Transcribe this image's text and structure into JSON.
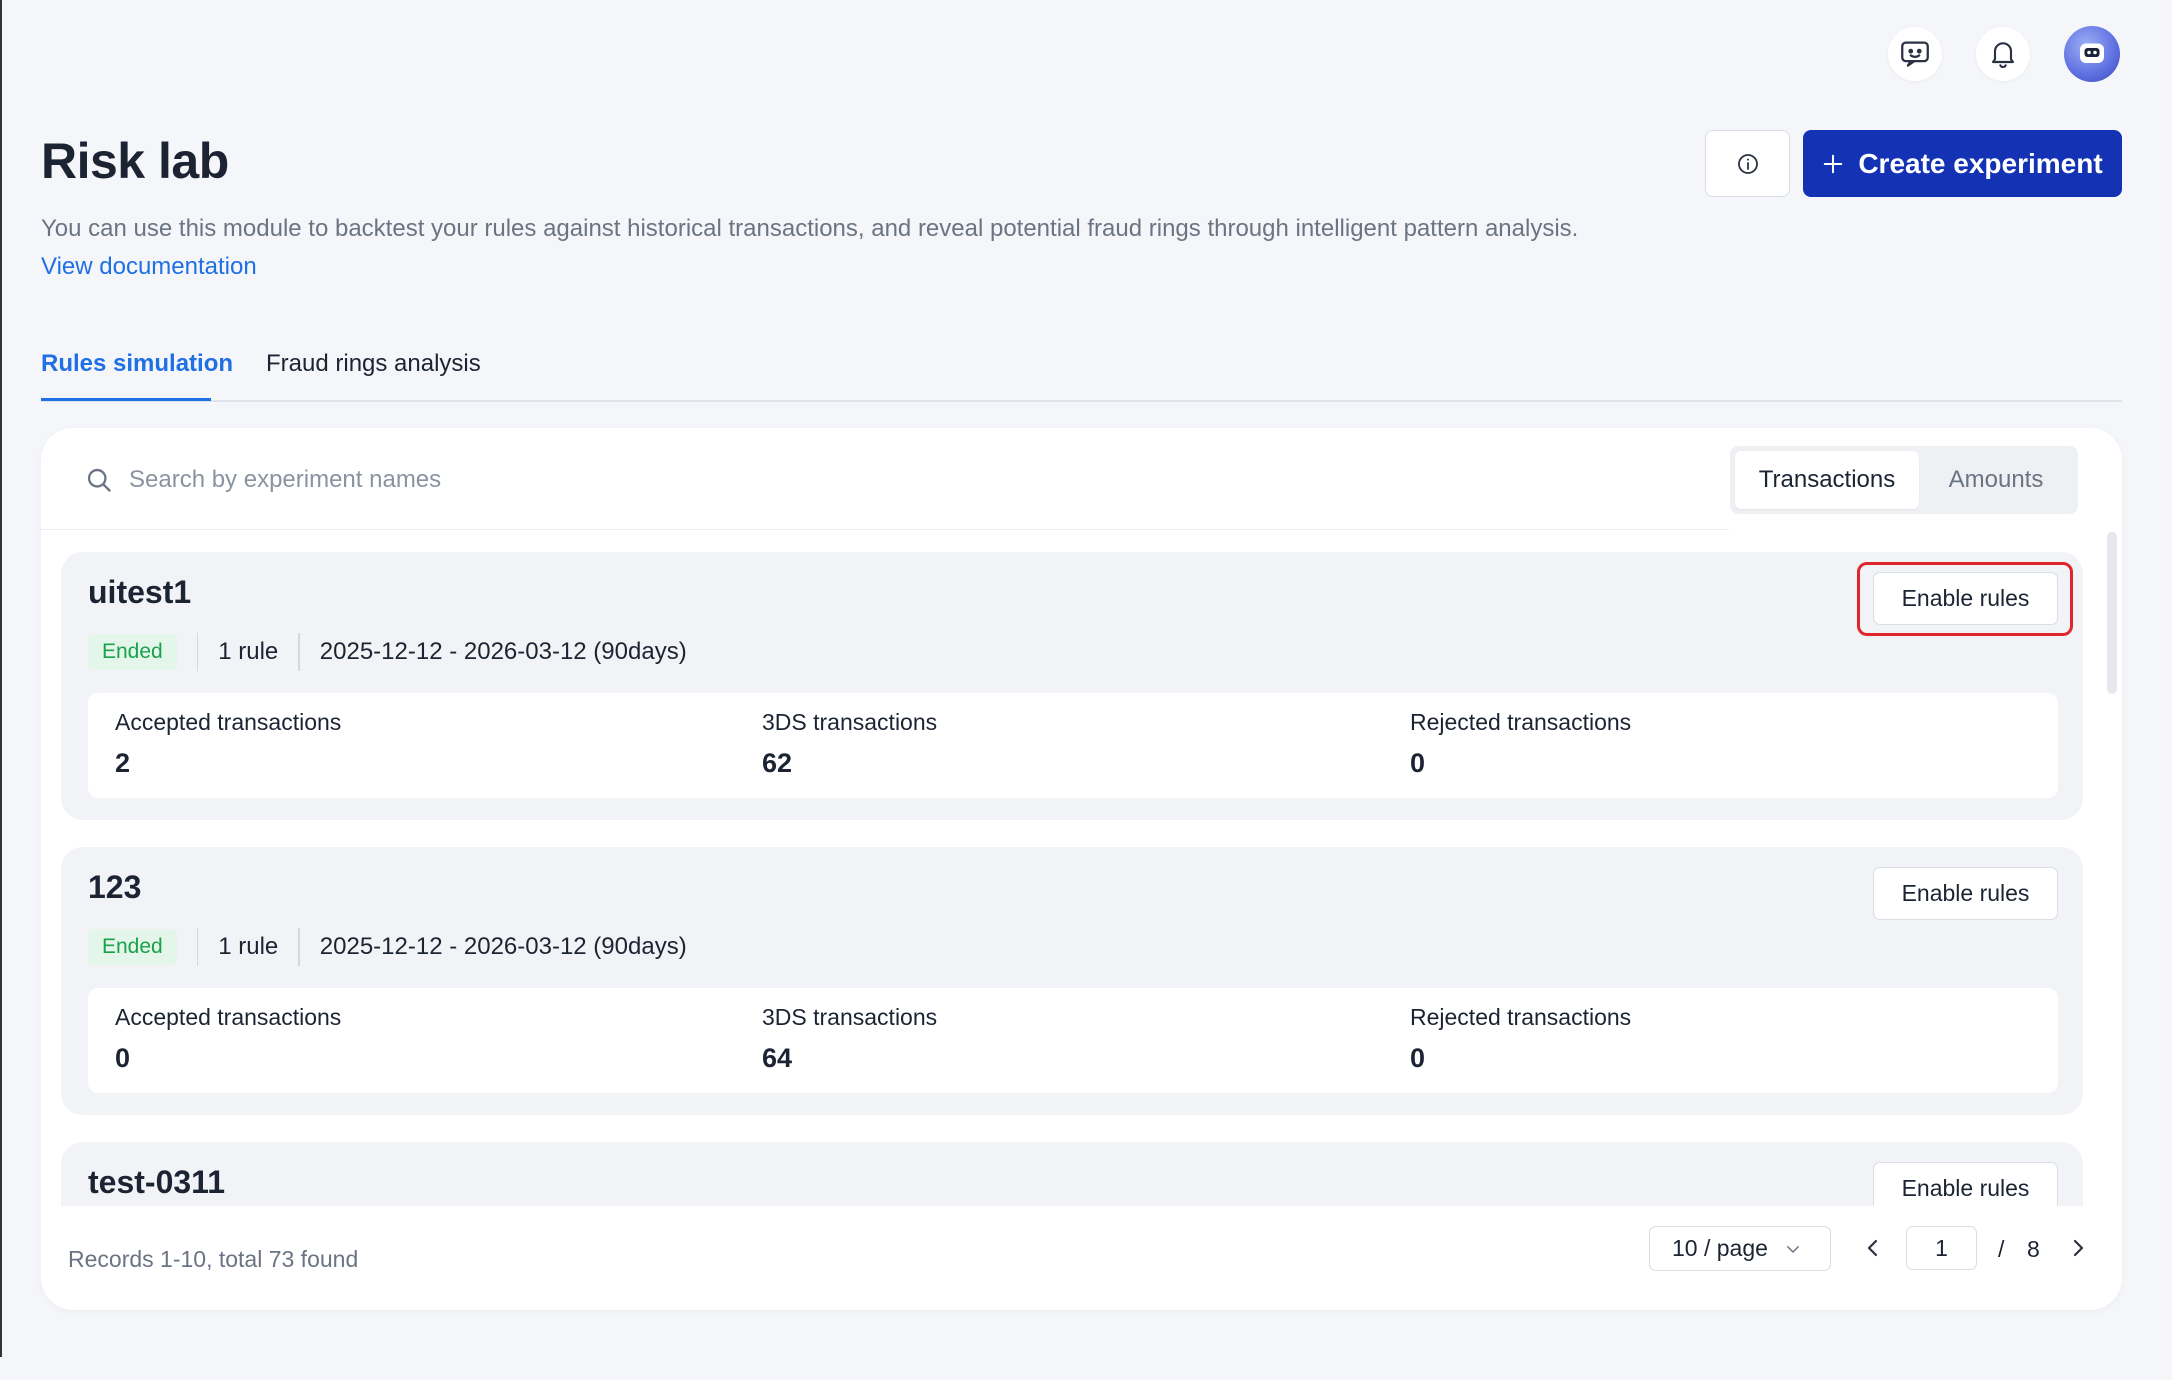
{
  "header": {
    "title": "Risk lab",
    "description": "You can use this module to backtest your rules against historical transactions, and reveal potential fraud rings through intelligent pattern analysis.",
    "doc_link": "View documentation",
    "create_label": "Create experiment"
  },
  "top_icons": [
    "feedback-icon",
    "bell-icon",
    "avatar"
  ],
  "tabs": [
    {
      "label": "Rules simulation",
      "active": true
    },
    {
      "label": "Fraud rings analysis",
      "active": false
    }
  ],
  "search": {
    "placeholder": "Search by experiment names",
    "value": ""
  },
  "toggle": [
    {
      "label": "Transactions",
      "active": true
    },
    {
      "label": "Amounts",
      "active": false
    }
  ],
  "experiments": [
    {
      "name": "uitest1",
      "status": "Ended",
      "rules": "1 rule",
      "period": "2025-12-12 - 2026-03-12 (90days)",
      "action": "Enable rules",
      "stats": [
        {
          "label": "Accepted transactions",
          "value": "2"
        },
        {
          "label": "3DS transactions",
          "value": "62"
        },
        {
          "label": "Rejected transactions",
          "value": "0"
        }
      ]
    },
    {
      "name": "123",
      "status": "Ended",
      "rules": "1 rule",
      "period": "2025-12-12 - 2026-03-12 (90days)",
      "action": "Enable rules",
      "stats": [
        {
          "label": "Accepted transactions",
          "value": "0"
        },
        {
          "label": "3DS transactions",
          "value": "64"
        },
        {
          "label": "Rejected transactions",
          "value": "0"
        }
      ]
    },
    {
      "name": "test-0311",
      "action": "Enable rules"
    }
  ],
  "pagination": {
    "records": "Records 1-10, total 73 found",
    "page_size": "10 / page",
    "current": "1",
    "separator": "/",
    "total_pages": "8"
  },
  "colors": {
    "primary": "#1432b4",
    "link": "#1f6fe5",
    "badge_text": "#18a24a",
    "badge_bg": "#e4f6ea",
    "highlight": "#e0262d"
  }
}
